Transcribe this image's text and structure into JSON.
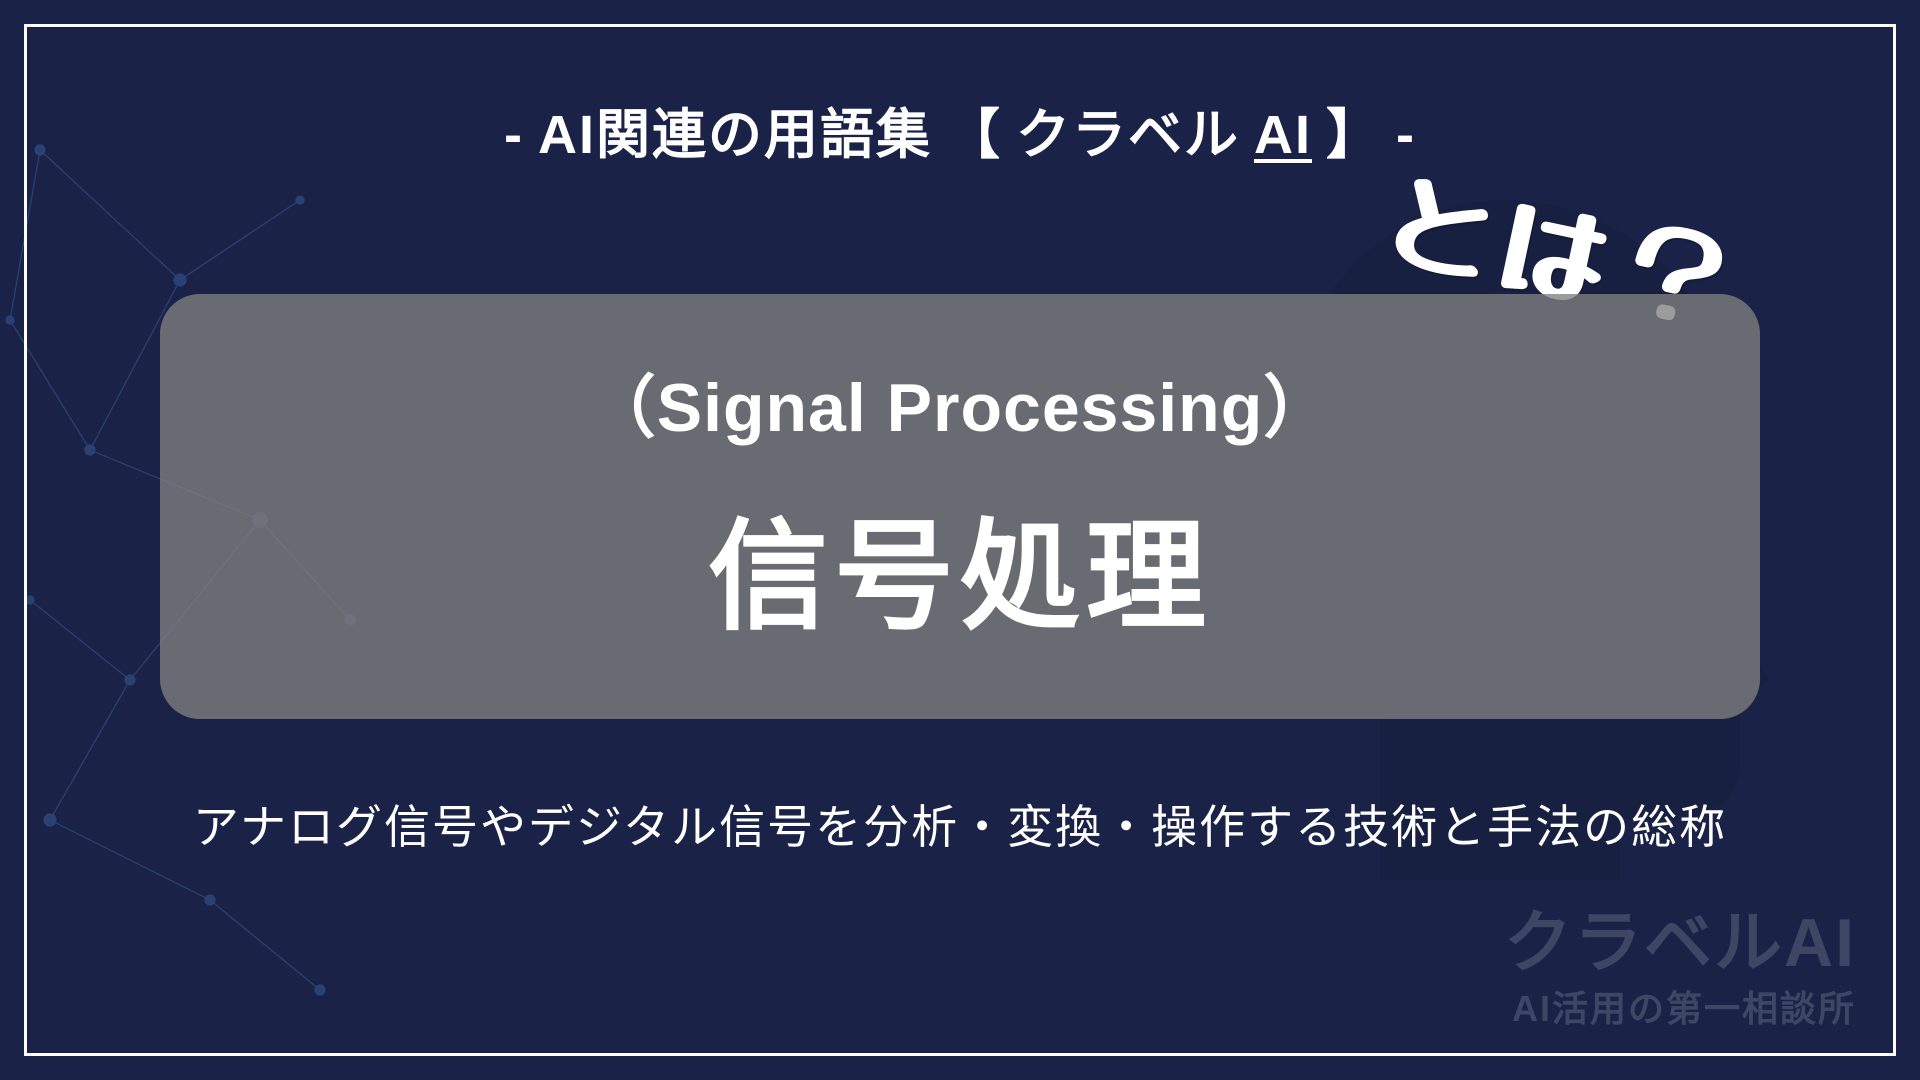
{
  "header": {
    "prefix": "-",
    "text_before": "AI関連の用語集",
    "bracket_open": "【",
    "brand_text": "クラベル",
    "brand_ai": "AI",
    "bracket_close": "】",
    "suffix": "-"
  },
  "term": {
    "english": "（Signal Processing）",
    "japanese": "信号処理",
    "question": "とは？"
  },
  "description": "アナログ信号やデジタル信号を分析・変換・操作する技術と手法の総称",
  "brand_corner": {
    "main": "クラベルAI",
    "sub": "AI活用の第一相談所"
  }
}
